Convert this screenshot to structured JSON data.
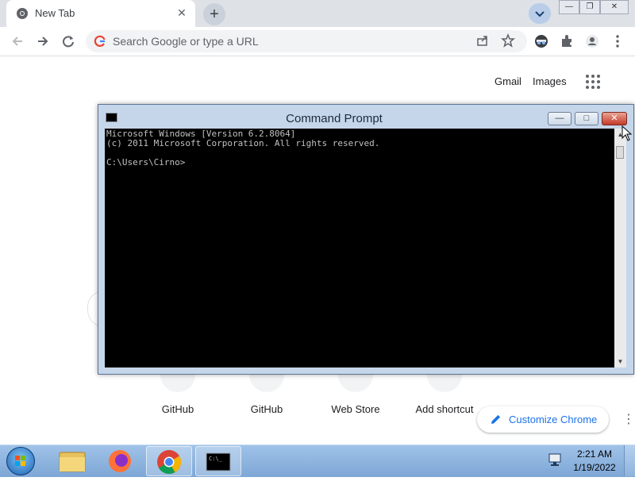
{
  "browser": {
    "tab": {
      "title": "New Tab",
      "close_symbol": "✕"
    },
    "new_tab_symbol": "+",
    "window_controls": {
      "minimize": "—",
      "restore": "❐",
      "close": "✕"
    },
    "omnibox": {
      "placeholder": "Search Google or type a URL"
    },
    "toolbar_icons": [
      "back-icon",
      "forward-icon",
      "reload-icon",
      "share-icon",
      "bookmark-star-icon",
      "incognito-icon",
      "extensions-icon",
      "profile-icon",
      "menu-icon"
    ]
  },
  "ntp": {
    "header_links": [
      "Gmail",
      "Images"
    ],
    "shortcuts": [
      {
        "label": "GitHub"
      },
      {
        "label": "GitHub"
      },
      {
        "label": "Web Store"
      },
      {
        "label": "Add shortcut"
      }
    ],
    "customize_label": "Customize Chrome"
  },
  "cmd": {
    "title": "Command Prompt",
    "lines": "Microsoft Windows [Version 6.2.8064]\n(c) 2011 Microsoft Corporation. All rights reserved.\n\nC:\\Users\\Cirno>",
    "buttons": {
      "minimize": "—",
      "maximize": "□",
      "close": "✕"
    }
  },
  "taskbar": {
    "pinned": [
      "explorer-icon",
      "firefox-icon",
      "chrome-icon",
      "cmd-icon"
    ],
    "clock": {
      "time": "2:21 AM",
      "date": "1/19/2022"
    }
  },
  "colors": {
    "chrome_tabstrip": "#dee1e6",
    "cmd_frame": "#c6d6ea",
    "cmd_background": "#000000",
    "cmd_text": "#c0c0c0",
    "taskbar": "#8fb3dc",
    "accent_blue": "#1a73e8"
  }
}
